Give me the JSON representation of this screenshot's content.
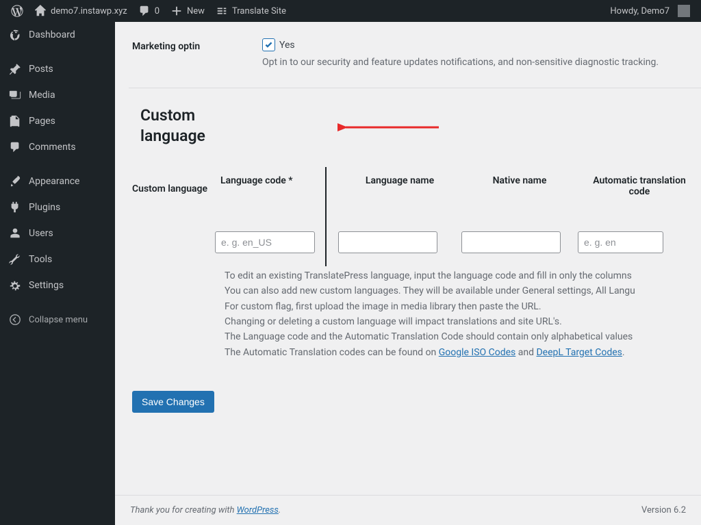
{
  "adminbar": {
    "site_name": "demo7.instawp.xyz",
    "comments_count": "0",
    "new_label": "New",
    "translate_label": "Translate Site",
    "greeting": "Howdy, Demo7"
  },
  "sidebar": {
    "items": [
      {
        "label": "Dashboard"
      },
      {
        "label": "Posts"
      },
      {
        "label": "Media"
      },
      {
        "label": "Pages"
      },
      {
        "label": "Comments"
      },
      {
        "label": "Appearance"
      },
      {
        "label": "Plugins"
      },
      {
        "label": "Users"
      },
      {
        "label": "Tools"
      },
      {
        "label": "Settings"
      }
    ],
    "collapse_label": "Collapse menu"
  },
  "optin": {
    "row_label": "Marketing optin",
    "yes_label": "Yes",
    "help": "Opt in to our security and feature updates notifications, and non-sensitive diagnostic tracking."
  },
  "section_heading": "Custom language",
  "custom_lang": {
    "row_label": "Custom language",
    "headers": {
      "code": "Language code *",
      "name": "Language name",
      "native": "Native name",
      "auto": "Automatic translation code"
    },
    "placeholders": {
      "code": "e. g. en_US",
      "auto": "e. g. en"
    },
    "desc_line1_a": "To edit an existing TranslatePress language, input the language code and fill in only the columns",
    "desc_line1_b": "You can also add new custom languages. They will be available under General settings, All Langu",
    "desc_line2": "For custom flag, first upload the image in media library then paste the URL.",
    "desc_line3": "Changing or deleting a custom language will impact translations and site URL's.",
    "desc_line4": "The Language code and the Automatic Translation Code should contain only alphabetical values",
    "desc_line5_a": "The Automatic Translation codes can be found on ",
    "desc_link1": "Google ISO Codes",
    "desc_line5_b": " and ",
    "desc_link2": "DeepL Target Codes",
    "desc_line5_c": "."
  },
  "save_label": "Save Changes",
  "footer": {
    "thank_a": "Thank you for creating with ",
    "wp": "WordPress",
    "thank_b": ".",
    "version": "Version 6.2"
  }
}
